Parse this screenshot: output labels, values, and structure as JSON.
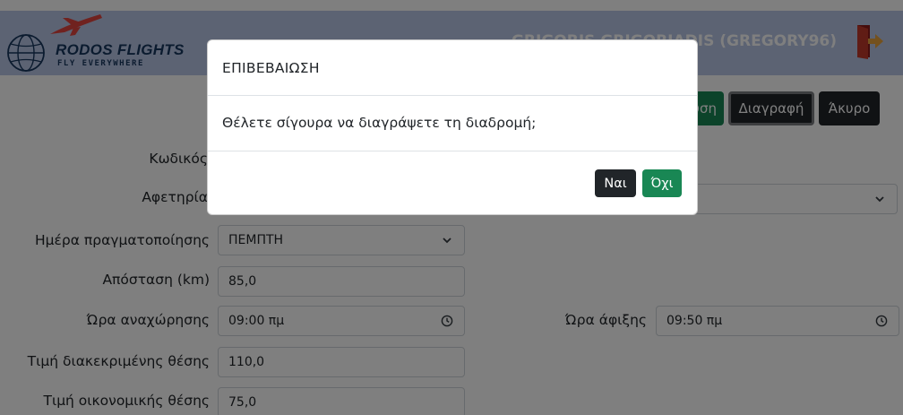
{
  "header": {
    "brand_name": "RODOS FLIGHTS",
    "brand_tagline": "FLY EVERYWHERE",
    "user_display": "GRIGORIS GRIGORIADIS (GREGORY96)",
    "logout_icon": "logout-door-icon",
    "colors": {
      "navbar": "#b9c6e6",
      "brand_text": "#17375e",
      "logo_plane": "#e0443e"
    }
  },
  "toolbar": {
    "save_label": "Αποθήκευση",
    "delete_label": "Διαγραφή",
    "cancel_label": "Άκυρο"
  },
  "form": {
    "code_label": "Κωδικός",
    "origin_label": "Αφετηρία",
    "day_label": "Ημέρα πραγματοποίησης",
    "day_value": "ΠΕΜΠΤΗ",
    "distance_label": "Απόσταση (km)",
    "distance_value": "85,0",
    "departure_label": "Ώρα αναχώρησης",
    "departure_value": "09:00 πμ",
    "arrival_label": "Ώρα άφιξης",
    "arrival_value": "09:50 πμ",
    "business_price_label": "Τιμή διακεκριμένης θέσης",
    "business_price_value": "110,0",
    "economy_price_label": "Τιμή οικονομικής θέσης",
    "economy_price_value": "75,0"
  },
  "modal": {
    "title": "ΕΠΙΒΕΒΑΙΩΣΗ",
    "message": "Θέλετε σίγουρα να διαγράψετε τη διαδρομή;",
    "yes_label": "Ναι",
    "no_label": "Όχι",
    "colors": {
      "yes": "#212529",
      "no": "#198754",
      "backdrop": "rgba(0,0,0,0.5)"
    }
  }
}
